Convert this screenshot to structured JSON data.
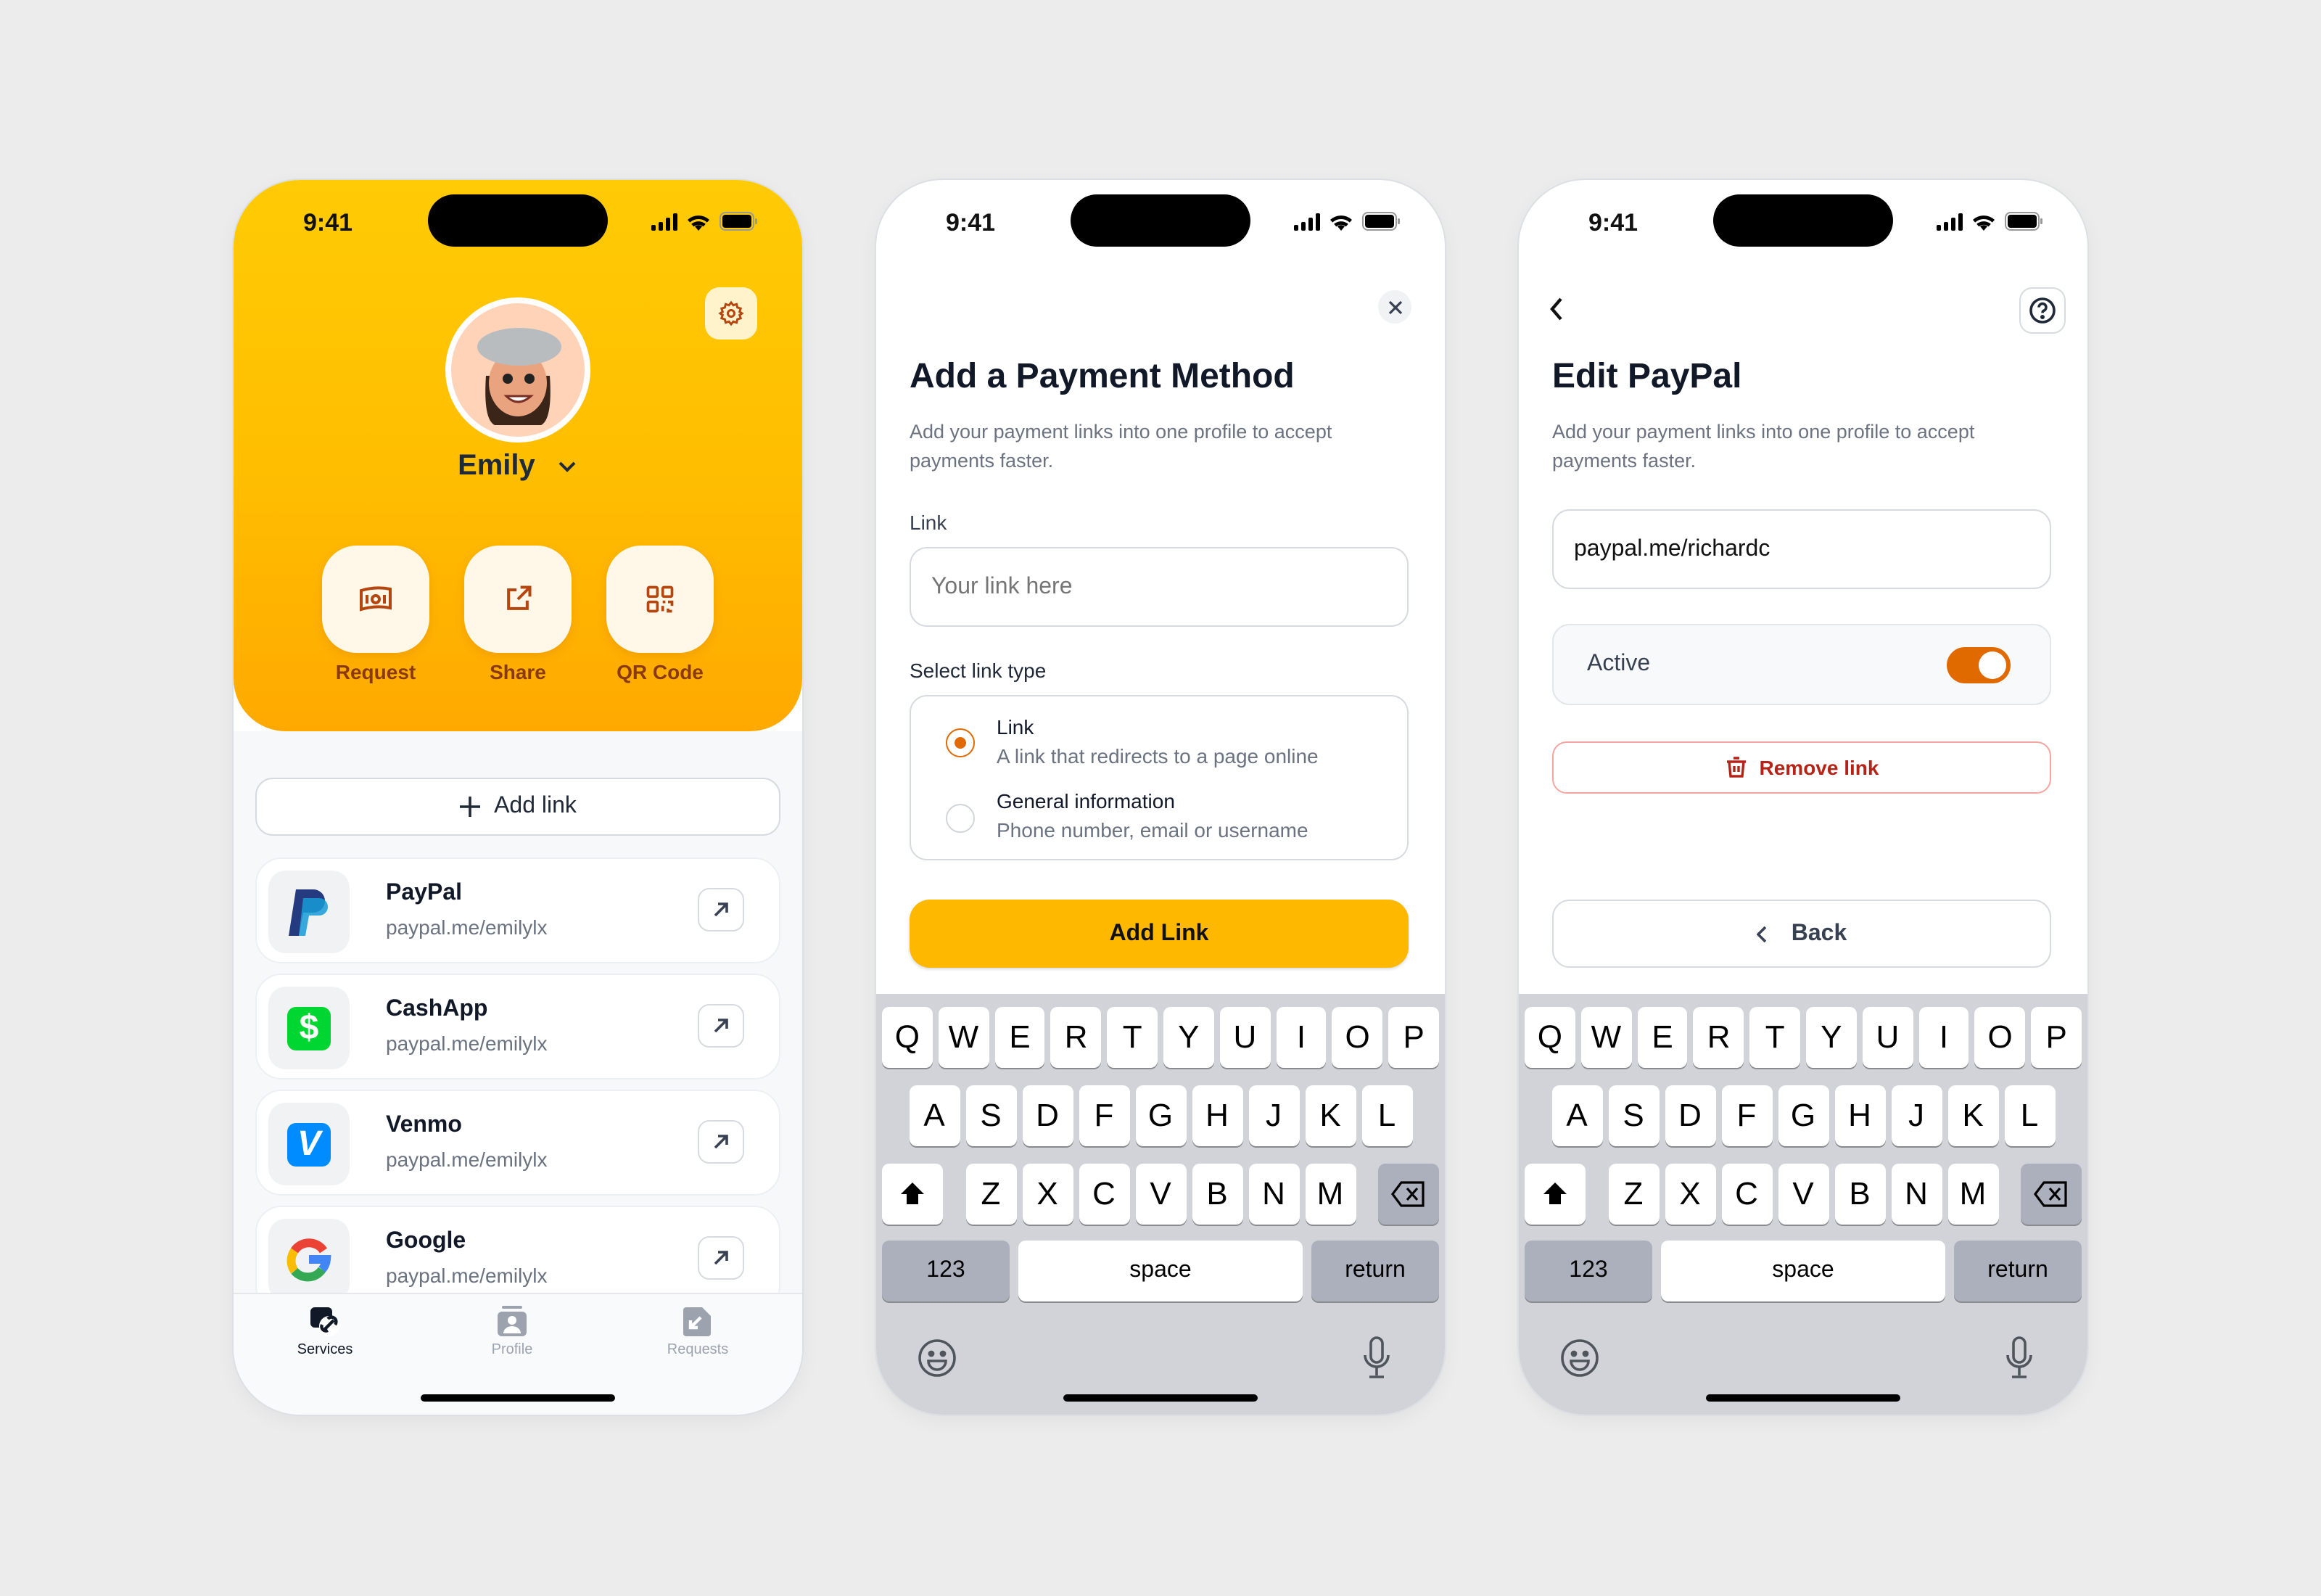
{
  "status": {
    "time": "9:41"
  },
  "colors": {
    "brand_yellow": "#ffbd00",
    "brown": "#8a3a10",
    "orange": "#e06a00",
    "danger": "#b42318",
    "keyboard_bg": "#d1d3d9"
  },
  "profile_screen": {
    "user_name": "Emily",
    "actions": [
      {
        "label": "Request",
        "icon": "money-icon"
      },
      {
        "label": "Share",
        "icon": "share-icon"
      },
      {
        "label": "QR Code",
        "icon": "qr-code-icon"
      }
    ],
    "add_link_label": "Add link",
    "services": [
      {
        "name": "PayPal",
        "link": "paypal.me/emilylx",
        "icon": "paypal-logo"
      },
      {
        "name": "CashApp",
        "link": "paypal.me/emilylx",
        "icon": "cashapp-logo"
      },
      {
        "name": "Venmo",
        "link": "paypal.me/emilylx",
        "icon": "venmo-logo"
      },
      {
        "name": "Google",
        "link": "paypal.me/emilylx",
        "icon": "google-logo"
      }
    ],
    "tabs": [
      {
        "label": "Services",
        "active": true
      },
      {
        "label": "Profile",
        "active": false
      },
      {
        "label": "Requests",
        "active": false
      }
    ]
  },
  "add_screen": {
    "title": "Add a Payment Method",
    "subtitle": "Add your payment links into one profile to accept payments faster.",
    "link_label": "Link",
    "link_placeholder": "Your link here",
    "type_label": "Select link type",
    "options": [
      {
        "title": "Link",
        "desc": "A link that redirects to a page online",
        "selected": true
      },
      {
        "title": "General information",
        "desc": "Phone number, email or username",
        "selected": false
      }
    ],
    "submit_label": "Add Link"
  },
  "edit_screen": {
    "title": "Edit PayPal",
    "subtitle": "Add your payment links into one profile to accept payments faster.",
    "link_value": "paypal.me/richardc",
    "active_label": "Active",
    "active": true,
    "remove_label": "Remove link",
    "back_label": "Back"
  },
  "keyboard": {
    "rows": [
      [
        "Q",
        "W",
        "E",
        "R",
        "T",
        "Y",
        "U",
        "I",
        "O",
        "P"
      ],
      [
        "A",
        "S",
        "D",
        "F",
        "G",
        "H",
        "J",
        "K",
        "L"
      ],
      [
        "Z",
        "X",
        "C",
        "V",
        "B",
        "N",
        "M"
      ]
    ],
    "numbers_label": "123",
    "space_label": "space",
    "return_label": "return"
  }
}
